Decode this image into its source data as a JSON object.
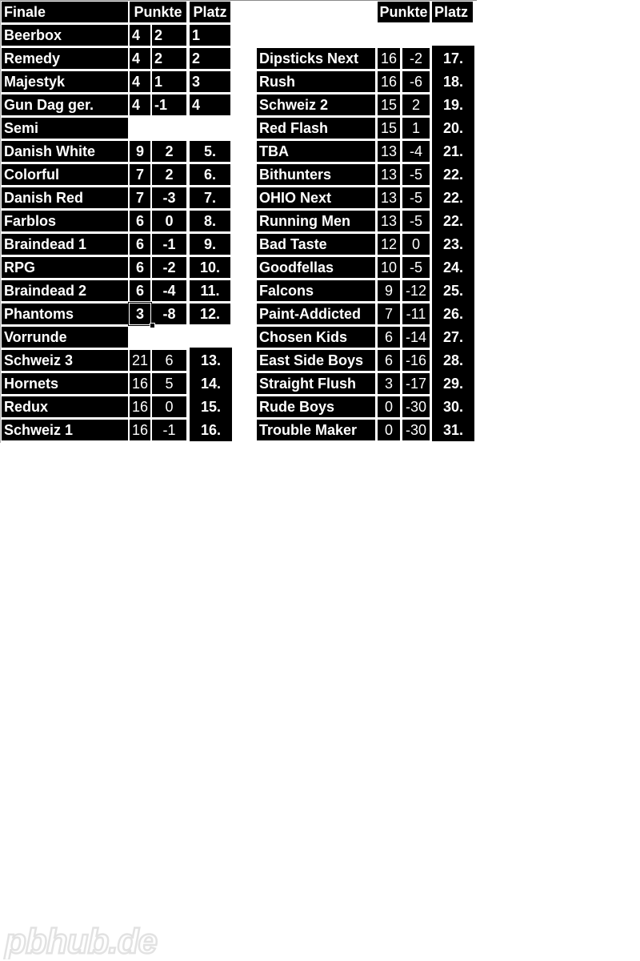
{
  "sheet": {
    "left": {
      "header": {
        "section": "Finale",
        "punkte": "Punkte",
        "platz": "Platz"
      },
      "finale": [
        {
          "team": "Beerbox",
          "p1": "4",
          "p2": "2",
          "platz": "1"
        },
        {
          "team": "Remedy",
          "p1": "4",
          "p2": "2",
          "platz": "2"
        },
        {
          "team": "Majestyk",
          "p1": "4",
          "p2": "1",
          "platz": "3"
        },
        {
          "team": "Gun Dag ger.",
          "p1": "4",
          "p2": "-1",
          "platz": "4"
        }
      ],
      "semi_label": "Semi",
      "semi": [
        {
          "team": "Danish White",
          "p1": "9",
          "p2": "2",
          "platz": "5."
        },
        {
          "team": "Colorful",
          "p1": "7",
          "p2": "2",
          "platz": "6."
        },
        {
          "team": "Danish Red",
          "p1": "7",
          "p2": "-3",
          "platz": "7."
        },
        {
          "team": "Farblos",
          "p1": "6",
          "p2": "0",
          "platz": "8."
        },
        {
          "team": "Braindead 1",
          "p1": "6",
          "p2": "-1",
          "platz": "9."
        },
        {
          "team": "RPG",
          "p1": "6",
          "p2": "-2",
          "platz": "10."
        },
        {
          "team": "Braindead 2",
          "p1": "6",
          "p2": "-4",
          "platz": "11."
        },
        {
          "team": "Phantoms",
          "p1": "3",
          "p2": "-8",
          "platz": "12."
        }
      ],
      "vorrunde_label": "Vorrunde",
      "vorrunde": [
        {
          "team": "Schweiz 3",
          "p1": "21",
          "p2": "6",
          "platz": "13."
        },
        {
          "team": "Hornets",
          "p1": "16",
          "p2": "5",
          "platz": "14."
        },
        {
          "team": "Redux",
          "p1": "16",
          "p2": "0",
          "platz": "15."
        },
        {
          "team": "Schweiz 1",
          "p1": "16",
          "p2": "-1",
          "platz": "16."
        }
      ]
    },
    "right": {
      "header": {
        "punkte": "Punkte",
        "platz": "Platz"
      },
      "rows": [
        {
          "team": "Dipsticks Next",
          "p1": "16",
          "p2": "-2",
          "platz": "17."
        },
        {
          "team": "Rush",
          "p1": "16",
          "p2": "-6",
          "platz": "18."
        },
        {
          "team": "Schweiz 2",
          "p1": "15",
          "p2": "2",
          "platz": "19."
        },
        {
          "team": "Red Flash",
          "p1": "15",
          "p2": "1",
          "platz": "20."
        },
        {
          "team": "TBA",
          "p1": "13",
          "p2": "-4",
          "platz": "21."
        },
        {
          "team": "Bithunters",
          "p1": "13",
          "p2": "-5",
          "platz": "22."
        },
        {
          "team": "OHIO Next",
          "p1": "13",
          "p2": "-5",
          "platz": "22."
        },
        {
          "team": "Running Men",
          "p1": "13",
          "p2": "-5",
          "platz": "22."
        },
        {
          "team": "Bad Taste",
          "p1": "12",
          "p2": "0",
          "platz": "23."
        },
        {
          "team": "Goodfellas",
          "p1": "10",
          "p2": "-5",
          "platz": "24."
        },
        {
          "team": "Falcons",
          "p1": "9",
          "p2": "-12",
          "platz": "25."
        },
        {
          "team": "Paint-Addicted",
          "p1": "7",
          "p2": "-11",
          "platz": "26."
        },
        {
          "team": "Chosen Kids",
          "p1": "6",
          "p2": "-14",
          "platz": "27."
        },
        {
          "team": "East Side Boys",
          "p1": "6",
          "p2": "-16",
          "platz": "28."
        },
        {
          "team": "Straight Flush",
          "p1": "3",
          "p2": "-17",
          "platz": "29."
        },
        {
          "team": "Rude Boys",
          "p1": "0",
          "p2": "-30",
          "platz": "30."
        },
        {
          "team": "Trouble Maker",
          "p1": "0",
          "p2": "-30",
          "platz": "31."
        }
      ]
    },
    "selected_cell": {
      "team": "Phantoms",
      "value": "3"
    }
  },
  "watermark": {
    "text": "pbhub.de",
    "color": "#e6e6e6"
  },
  "colors": {
    "cell_bg": "#000000",
    "cell_text": "#ffffff",
    "page_bg": "#ffffff"
  }
}
